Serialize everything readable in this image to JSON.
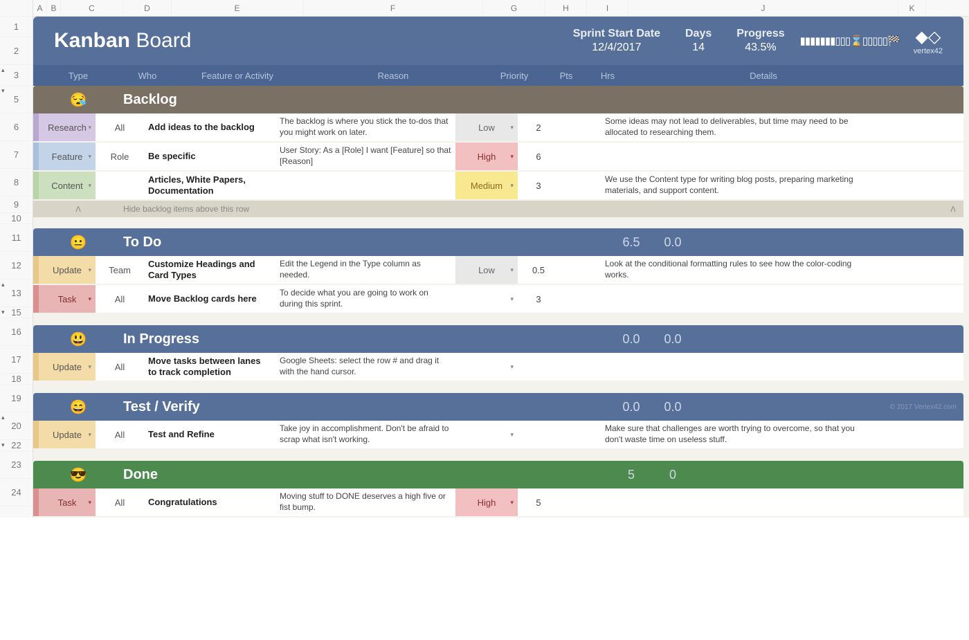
{
  "cols": [
    "A",
    "B",
    "C",
    "D",
    "E",
    "F",
    "G",
    "H",
    "I",
    "J",
    "K"
  ],
  "rownums": [
    "1",
    "2",
    "3",
    "5",
    "6",
    "7",
    "8",
    "9",
    "10",
    "11",
    "12",
    "13",
    "15",
    "16",
    "17",
    "18",
    "19",
    "20",
    "22",
    "23",
    "24"
  ],
  "header": {
    "title_bold": "Kanban",
    "title_light": "Board",
    "sprint_label": "Sprint Start Date",
    "sprint_date": "12/4/2017",
    "days_label": "Days",
    "days_val": "14",
    "progress_label": "Progress",
    "progress_val": "43.5%",
    "flags": "▮▮▮▮▮▮▮▯▯▯⌛▯▯▯▯▯🏁",
    "logo_text": "vertex42"
  },
  "subheader": {
    "type": "Type",
    "who": "Who",
    "feature": "Feature or Activity",
    "reason": "Reason",
    "priority": "Priority",
    "pts": "Pts",
    "hrs": "Hrs",
    "details": "Details"
  },
  "sections": {
    "backlog": {
      "icon": "😪",
      "title": "Backlog"
    },
    "todo": {
      "icon": "😐",
      "title": "To Do",
      "pts": "6.5",
      "hrs": "0.0"
    },
    "inprogress": {
      "icon": "😃",
      "title": "In Progress",
      "pts": "0.0",
      "hrs": "0.0"
    },
    "test": {
      "icon": "😄",
      "title": "Test / Verify",
      "pts": "0.0",
      "hrs": "0.0",
      "copy": "© 2017 Vertex42.com"
    },
    "done": {
      "icon": "😎",
      "title": "Done",
      "pts": "5",
      "hrs": "0"
    }
  },
  "hiderow": {
    "arrow": "ᐱ",
    "text": "Hide backlog items above this row"
  },
  "rows": {
    "r6": {
      "type": "Research",
      "who": "All",
      "feat": "Add ideas to the backlog",
      "reason": "The backlog is where you stick the to-dos that you might work on later.",
      "pri": "Low",
      "pts": "2",
      "details": "Some ideas may not lead to deliverables, but time may need to be allocated to researching them."
    },
    "r7": {
      "type": "Feature",
      "who": "Role",
      "feat": "Be specific",
      "reason": "User Story: As a [Role] I want [Feature] so that [Reason]",
      "pri": "High",
      "pts": "6",
      "details": ""
    },
    "r8": {
      "type": "Content",
      "who": "",
      "feat": "Articles, White Papers, Documentation",
      "reason": "",
      "pri": "Medium",
      "pts": "3",
      "details": "We use the Content type for writing blog posts, preparing marketing materials, and support content."
    },
    "r12": {
      "type": "Update",
      "who": "Team",
      "feat": "Customize Headings and Card Types",
      "reason": "Edit the Legend in the Type column as needed.",
      "pri": "Low",
      "pts": "0.5",
      "details": "Look at the conditional formatting rules to see how the color-coding works."
    },
    "r13": {
      "type": "Task",
      "who": "All",
      "feat": "Move Backlog cards here",
      "reason": "To decide what you are going to work on during this sprint.",
      "pri": "",
      "pts": "3",
      "details": ""
    },
    "r17": {
      "type": "Update",
      "who": "All",
      "feat": "Move tasks between lanes to track completion",
      "reason": "Google Sheets: select the row # and drag it with the hand cursor.",
      "pri": "",
      "pts": "",
      "details": ""
    },
    "r20": {
      "type": "Update",
      "who": "All",
      "feat": "Test and Refine",
      "reason": "Take joy in accomplishment. Don't be afraid to scrap what isn't working.",
      "pri": "",
      "pts": "",
      "details": "Make sure that challenges are worth trying to overcome, so that you don't waste time on useless stuff."
    },
    "r24": {
      "type": "Task",
      "who": "All",
      "feat": "Congratulations",
      "reason": "Moving stuff to DONE deserves a high five or fist bump.",
      "pri": "High",
      "pts": "5",
      "details": ""
    }
  }
}
